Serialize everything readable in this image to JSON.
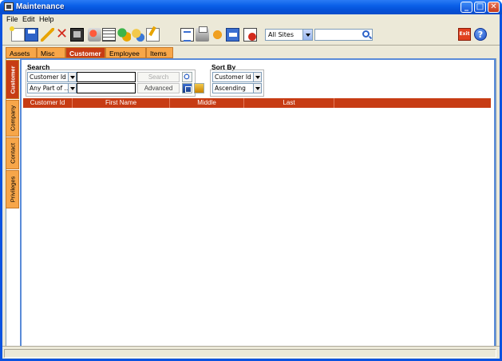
{
  "window": {
    "title": "Maintenance"
  },
  "menu": [
    "File",
    "Edit",
    "Help"
  ],
  "toolbar": {
    "site_select": "All Sites",
    "exit_label": "Exit",
    "help_label": "?"
  },
  "tabs": [
    "Assets",
    "Misc",
    "Customer",
    "Employee",
    "Items"
  ],
  "active_tab": "Customer",
  "side_tabs": [
    "Customer",
    "Company",
    "Contact",
    "Privileges"
  ],
  "search": {
    "heading": "Search",
    "field_select": "Customer Id",
    "match_select": "Any Part of ...",
    "search_button": "Search",
    "advanced_button": "Advanced"
  },
  "sort": {
    "heading": "Sort By",
    "field_select": "Customer Id",
    "order_select": "Ascending"
  },
  "grid": {
    "columns": [
      "Customer Id",
      "First Name",
      "Middle",
      "Last"
    ]
  },
  "colors": {
    "accent_active": "#c73c14",
    "tab_inactive": "#f7a649",
    "title_bar": "#0a5fe8"
  }
}
